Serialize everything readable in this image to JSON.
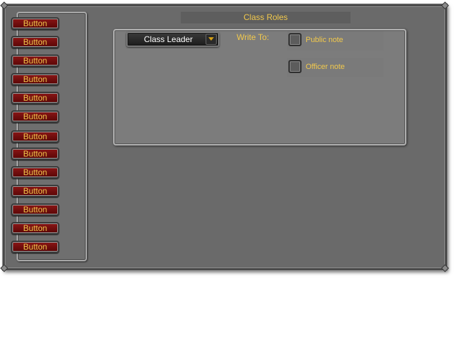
{
  "title": "Class Roles",
  "sidebar": {
    "buttons": [
      "Button",
      "Button",
      "Button",
      "Button",
      "Button",
      "Button",
      "Button",
      "Button",
      "Button",
      "Button",
      "Button",
      "Button",
      "Button"
    ]
  },
  "role_dropdown": {
    "selected": "Class Leader"
  },
  "write_to": {
    "label": "Write To:",
    "options": [
      {
        "label": "Public note",
        "checked": false
      },
      {
        "label": "Officer note",
        "checked": false
      }
    ]
  },
  "colors": {
    "label_gold": "#f2c94c",
    "button_red": "#6e0a0a",
    "frame_gray": "#6a6a6a"
  }
}
